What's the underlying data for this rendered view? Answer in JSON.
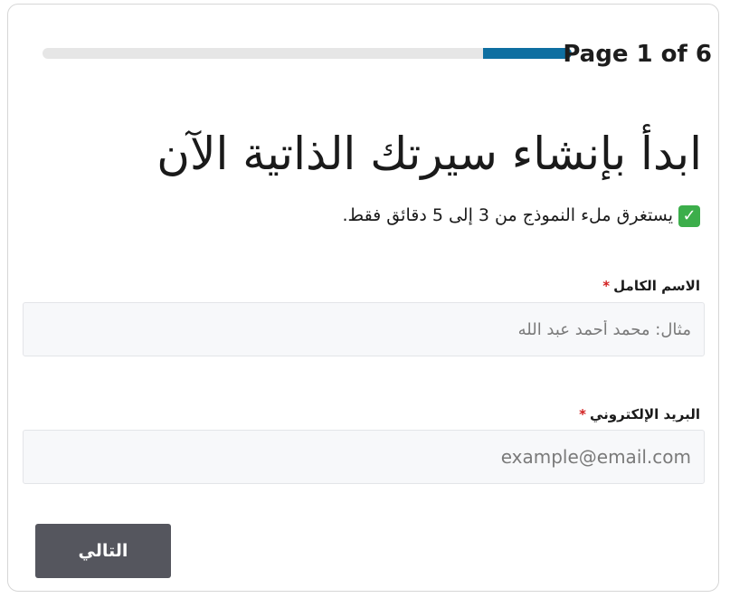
{
  "progress": {
    "page_label": "Page 1 of 6",
    "fraction": 0.1667,
    "track_color": "#e6e6e6",
    "fill_color": "#0e6fa1"
  },
  "form": {
    "title": "ابدأ بإنشاء سيرتك الذاتية الآن",
    "subtitle": "يستغرق ملء النموذج من 3 إلى 5 دقائق فقط.",
    "subtitle_icon": "check-mark-icon",
    "fields": {
      "full_name": {
        "label": "الاسم الكامل",
        "required_mark": "*",
        "value": "",
        "placeholder": "مثال: محمد أحمد عبد الله"
      },
      "email": {
        "label": "البريد الإلكتروني",
        "required_mark": "*",
        "value": "",
        "placeholder": "example@email.com"
      }
    },
    "next_button": {
      "label": "التالي",
      "color": "#55565e"
    },
    "required_color": "#d21f1f"
  }
}
